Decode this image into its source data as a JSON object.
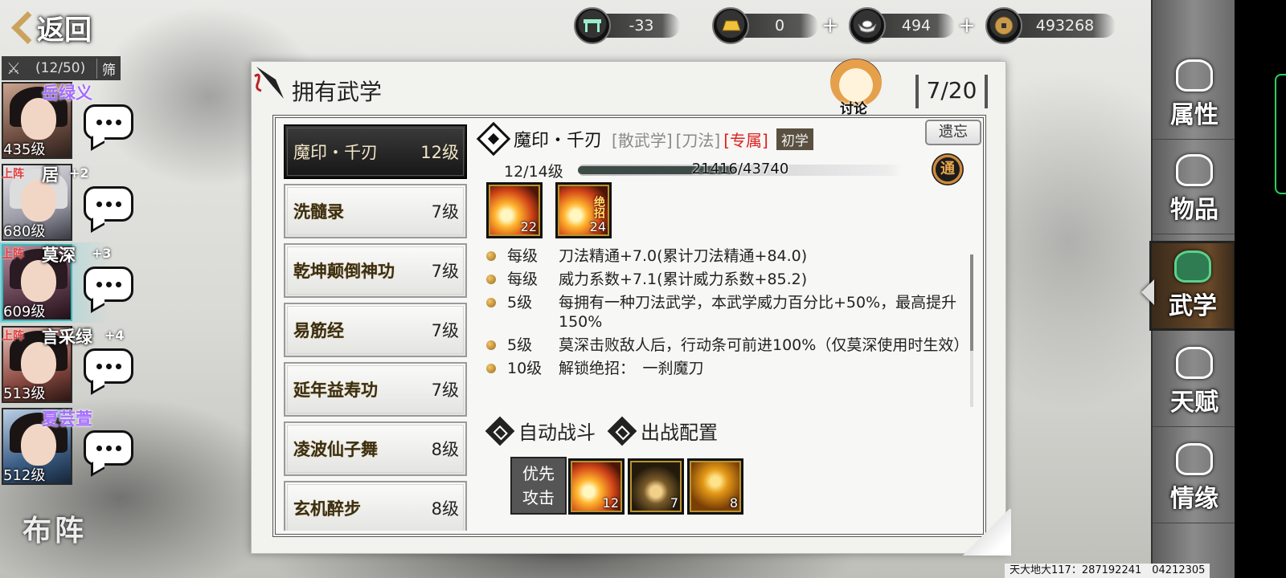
{
  "header": {
    "back_label": "返回"
  },
  "currencies": [
    {
      "icon": "bench-icon",
      "value": "-33",
      "plus": ""
    },
    {
      "icon": "gold-bar-icon",
      "value": "0",
      "plus": "+"
    },
    {
      "icon": "silver-ingot-icon",
      "value": "494",
      "plus": "+"
    },
    {
      "icon": "coin-icon",
      "value": "493268",
      "plus": ""
    }
  ],
  "team": {
    "count": "(12/50)",
    "filter_label": "筛",
    "members": [
      {
        "name": "岳绿义",
        "level": "435级",
        "tag": "",
        "plus": ""
      },
      {
        "name": "居",
        "level": "680级",
        "tag": "上阵",
        "plus": "+2"
      },
      {
        "name": "莫深",
        "level": "609级",
        "tag": "上阵",
        "plus": "+3"
      },
      {
        "name": "言采绿",
        "level": "513级",
        "tag": "上阵",
        "plus": "+4"
      },
      {
        "name": "夏芸萱",
        "level": "512级",
        "tag": "",
        "plus": ""
      }
    ],
    "formation_label": "布阵"
  },
  "panel": {
    "title": "拥有武学",
    "count": "7/20",
    "discuss_label": "讨论",
    "skills": [
      {
        "name": "魔印・千刃",
        "level": "12级",
        "active": true
      },
      {
        "name": "洗髓录",
        "level": "7级",
        "active": false
      },
      {
        "name": "乾坤颠倒神功",
        "level": "7级",
        "active": false
      },
      {
        "name": "易筋经",
        "level": "7级",
        "active": false
      },
      {
        "name": "延年益寿功",
        "level": "7级",
        "active": false
      },
      {
        "name": "凌波仙子舞",
        "level": "8级",
        "active": false
      },
      {
        "name": "玄机醉步",
        "level": "8级",
        "active": false
      }
    ],
    "detail": {
      "name": "魔印・千刃",
      "tag1": "[散武学]",
      "tag2": "[刀法]",
      "tag3": "[专属]",
      "stage": "初学",
      "forget_label": "遗忘",
      "level_progress": "12/14级",
      "exp_text": "21416/43740",
      "exp_fraction": 0.49,
      "tong_label": "通",
      "move_icons": [
        {
          "num": "22",
          "ult": ""
        },
        {
          "num": "24",
          "ult": "绝招"
        }
      ],
      "effects": [
        {
          "level": "每级",
          "text": "刀法精通+7.0(累计刀法精通+84.0)"
        },
        {
          "level": "每级",
          "text": "威力系数+7.1(累计威力系数+85.2)"
        },
        {
          "level": "5级",
          "text": "每拥有一种刀法武学，本武学威力百分比+50%，最高提升150%"
        },
        {
          "level": "5级",
          "text": "莫深击败敌人后，行动条可前进100%（仅莫深使用时生效）"
        },
        {
          "level": "10级",
          "text": "解锁绝招：　一刹魔刀"
        }
      ],
      "auto_battle_label": "自动战斗",
      "battle_config_label": "出战配置",
      "priority_label_1": "优先",
      "priority_label_2": "攻击",
      "battle_skills": [
        {
          "num": "12"
        },
        {
          "num": "7"
        },
        {
          "num": "8"
        }
      ]
    }
  },
  "right_nav": [
    {
      "label": "属性",
      "icon": "attribute-icon",
      "active": false
    },
    {
      "label": "物品",
      "icon": "item-box-icon",
      "active": false
    },
    {
      "label": "武学",
      "icon": "martial-book-icon",
      "active": true
    },
    {
      "label": "天赋",
      "icon": "talent-icon",
      "active": false
    },
    {
      "label": "情缘",
      "icon": "heart-icon",
      "active": false
    }
  ],
  "footer_id": "天大地大117：287192241　04212305"
}
